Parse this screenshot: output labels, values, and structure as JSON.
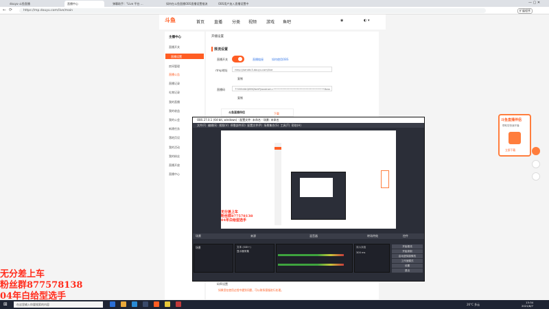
{
  "browser": {
    "tabs": [
      "douyu-斗鱼直播",
      "直播中心",
      "弹幕助手：“Live 平台 ...",
      "如何在斗鱼直播OBS直播设置推流",
      "OBS用户加入直播设置中"
    ],
    "url": "https://mp.douyu.com/live/main",
    "window_label": "扩展程序"
  },
  "site": {
    "logo": "斗鱼",
    "nav": [
      "首页",
      "直播",
      "分类",
      "视频",
      "游戏",
      "鱼吧"
    ],
    "sidebar_title": "主播中心",
    "sidebar": [
      "直播开关",
      "直播设置",
      "房间管理",
      "直播公告",
      "直播记录",
      "礼物记录",
      "我的直播",
      "我的收益",
      "我的公会",
      "新建任务",
      "落地页设",
      "我的活动",
      "我的粉丝",
      "直播开放",
      "直播中心"
    ],
    "content_title": "开播设置",
    "section_title": "推流设置",
    "stream_label": "直播开关",
    "links": [
      "直播链接",
      "如何使用OBS"
    ],
    "rtmp_label": "rtmp地址",
    "rtmp_value": "rtmp://sendtc3.douyu.com/live",
    "copy_label": "复制",
    "key_label": "直播码",
    "key_value": "7705548rQ8MQfwlrFJwsstrom=•••••••••••••••••••••••••••••••••••8uss",
    "helper_title": "斗鱼直播伴侣",
    "helper_btn": "下载",
    "bottom_note": "如果您在使用过程中遇到问题，可以联系客服进行处理。"
  },
  "promo": {
    "title": "斗鱼直播伴侣",
    "sub": "帮助您快速开播",
    "btn": "立即下载"
  },
  "obs": {
    "title": "OBS 27.0.1 (64-bit, windows) - 配置文件: 未命名 - 场景: 未命名",
    "menu": [
      "文件(F)",
      "编辑(E)",
      "视图(V)",
      "停靠部件(D)",
      "配置文件(P)",
      "场景集合(S)",
      "工具(T)",
      "帮助(H)"
    ],
    "panels": [
      "场景",
      "来源",
      "混音器",
      "转场特效",
      "控件"
    ],
    "scene": "场景",
    "sources": [
      "文本 (GDI+)",
      "显示器采集"
    ],
    "controls": [
      "开始推流",
      "开始录制",
      "启动虚拟摄像机",
      "工作室模式",
      "设置",
      "退出"
    ],
    "transition": "淡入淡出",
    "duration": "300 ms"
  },
  "overlay": {
    "line1": "无分差上车",
    "line2": "粉丝群877578138",
    "line3": "04年白给型选手"
  },
  "taskbar": {
    "search": "在这里输入你要搜索的内容",
    "weather": "26°C 多云",
    "time": "13:34",
    "date": "2021/8/7"
  },
  "colors": {
    "accent": "#ff5d23",
    "overlay": "#ff2a1a"
  }
}
